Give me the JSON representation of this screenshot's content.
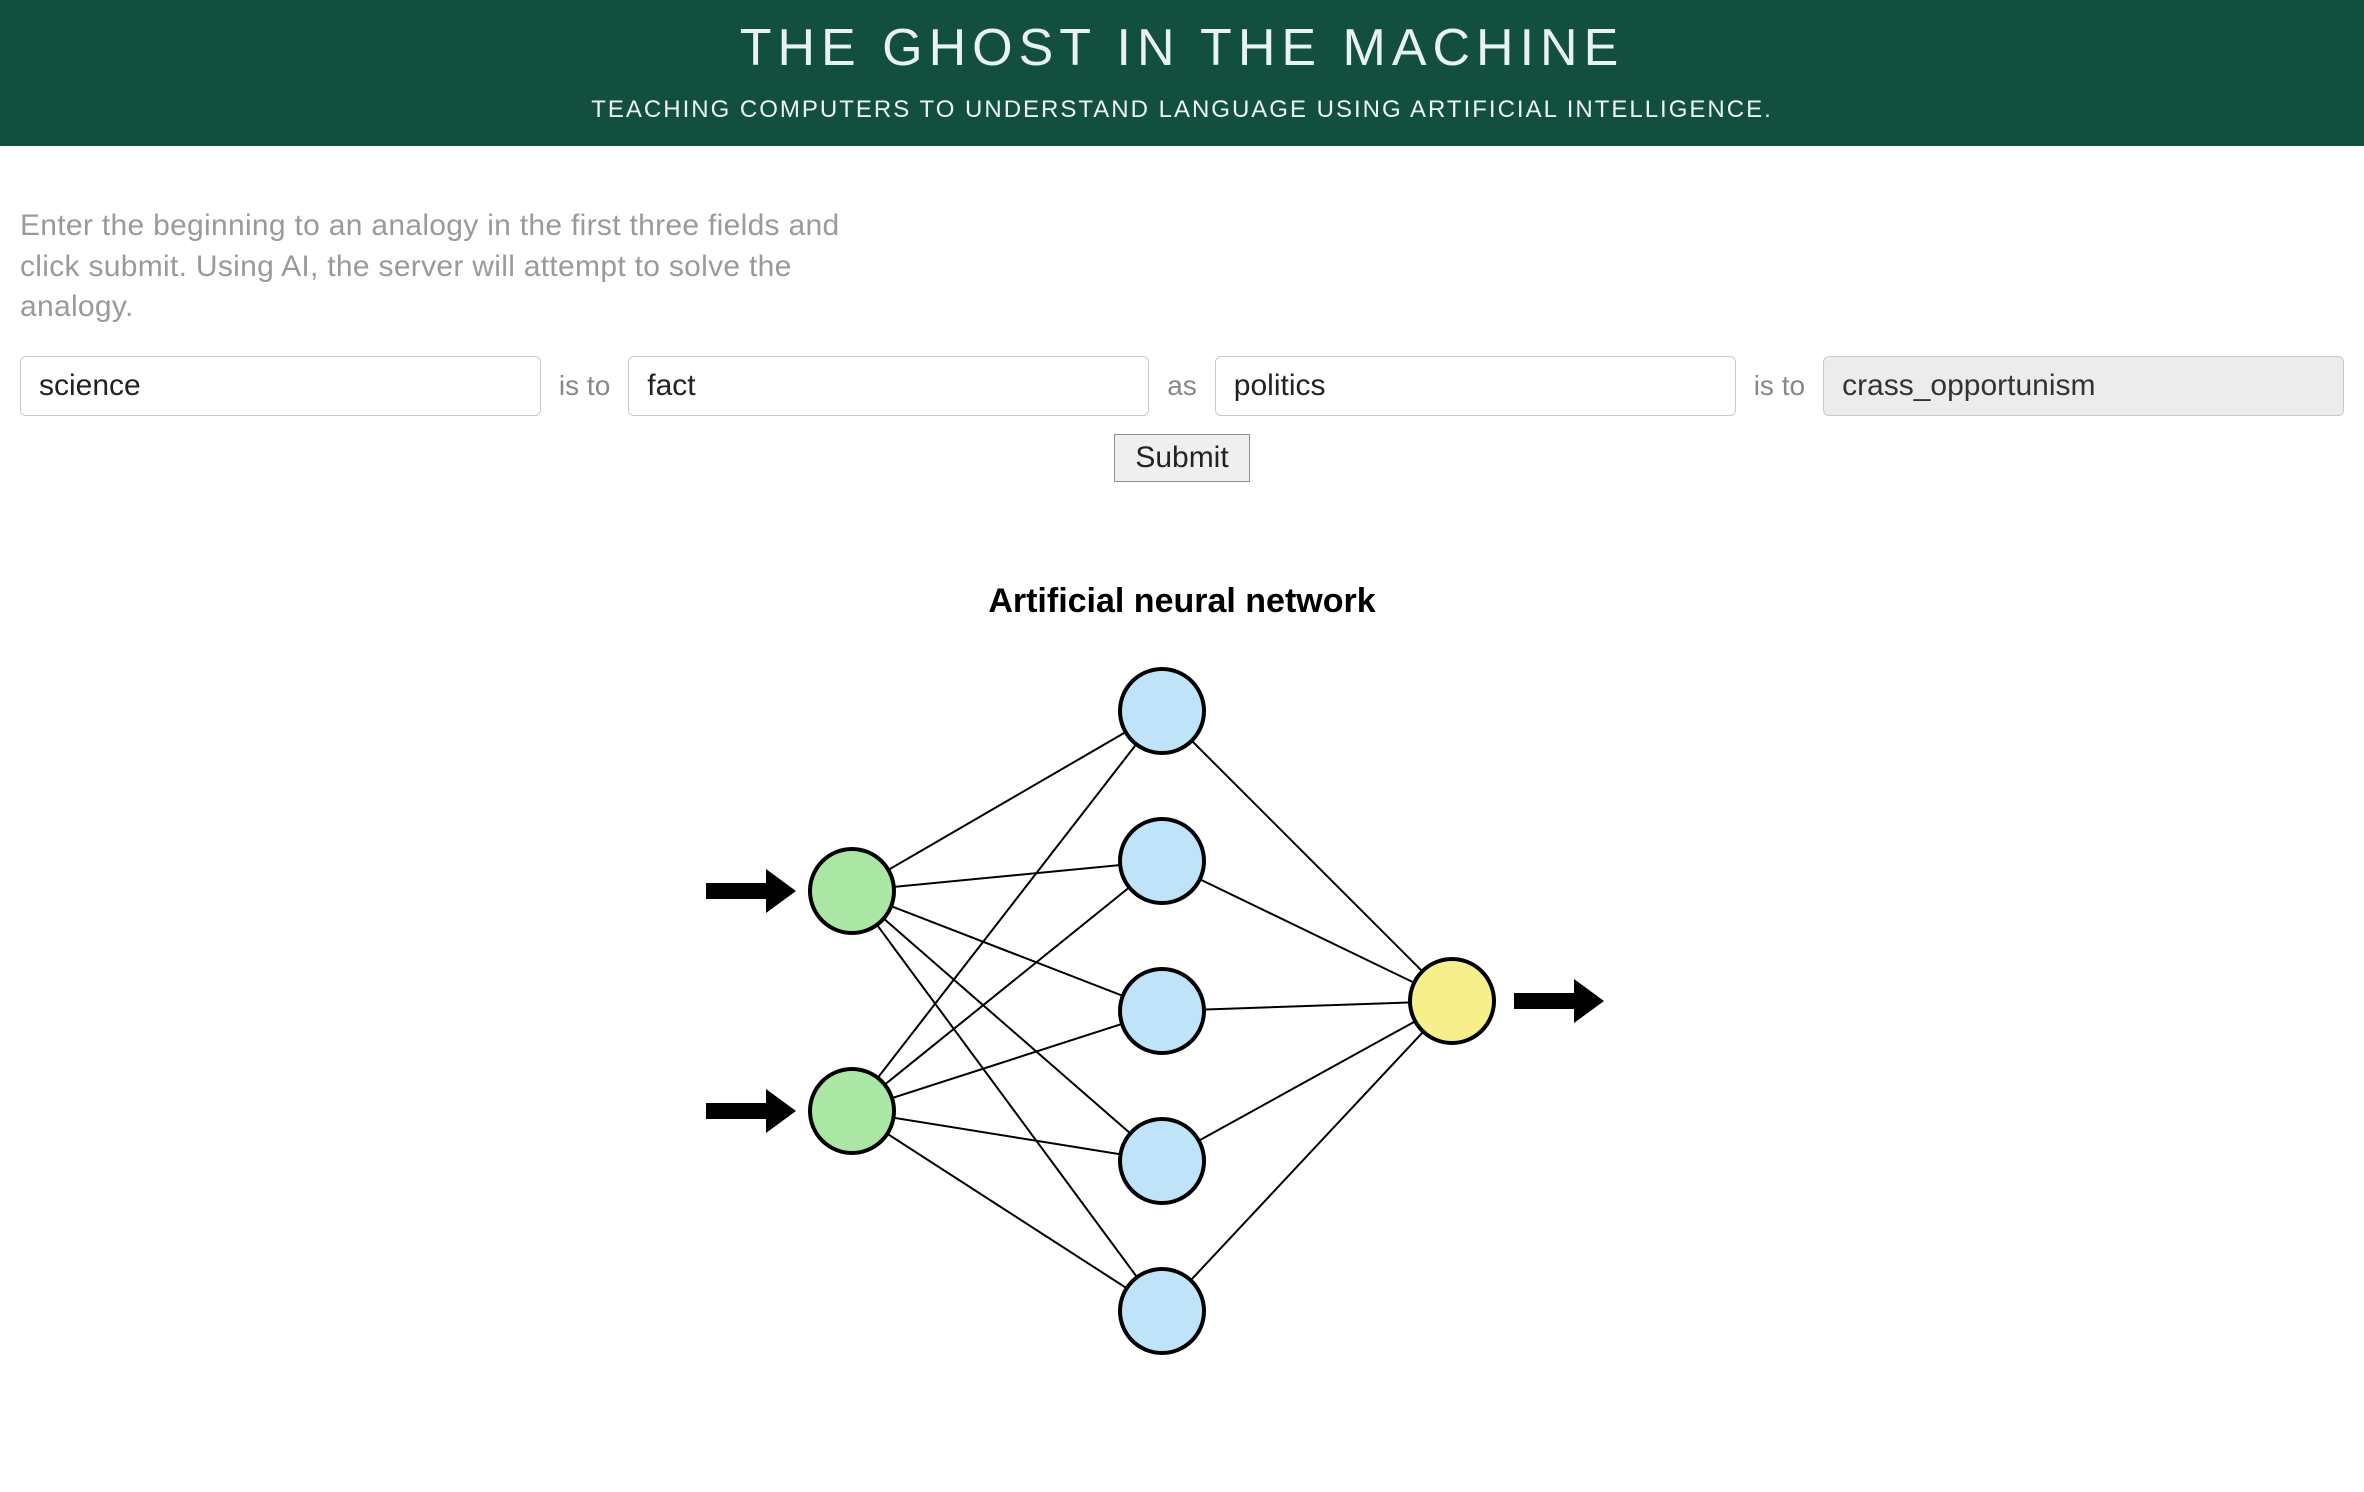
{
  "header": {
    "title": "THE GHOST IN THE MACHINE",
    "subtitle": "TEACHING COMPUTERS TO UNDERSTAND LANGUAGE USING ARTIFICIAL INTELLIGENCE."
  },
  "instructions": "Enter the beginning to an analogy in the first three fields and click submit. Using AI, the server will attempt to solve the analogy.",
  "form": {
    "word1": "science",
    "word2": "fact",
    "word3": "politics",
    "result": "crass_opportunism",
    "conn_is_to": "is to",
    "conn_as": "as",
    "submit_label": "Submit"
  },
  "diagram": {
    "title": "Artificial neural network",
    "colors": {
      "input_node": "#aae7a5",
      "hidden_node": "#bfe4f9",
      "output_node": "#f7ef8b",
      "stroke": "#000000",
      "arrow": "#000000"
    },
    "layers": {
      "input_count": 2,
      "hidden_count": 5,
      "output_count": 1
    }
  }
}
